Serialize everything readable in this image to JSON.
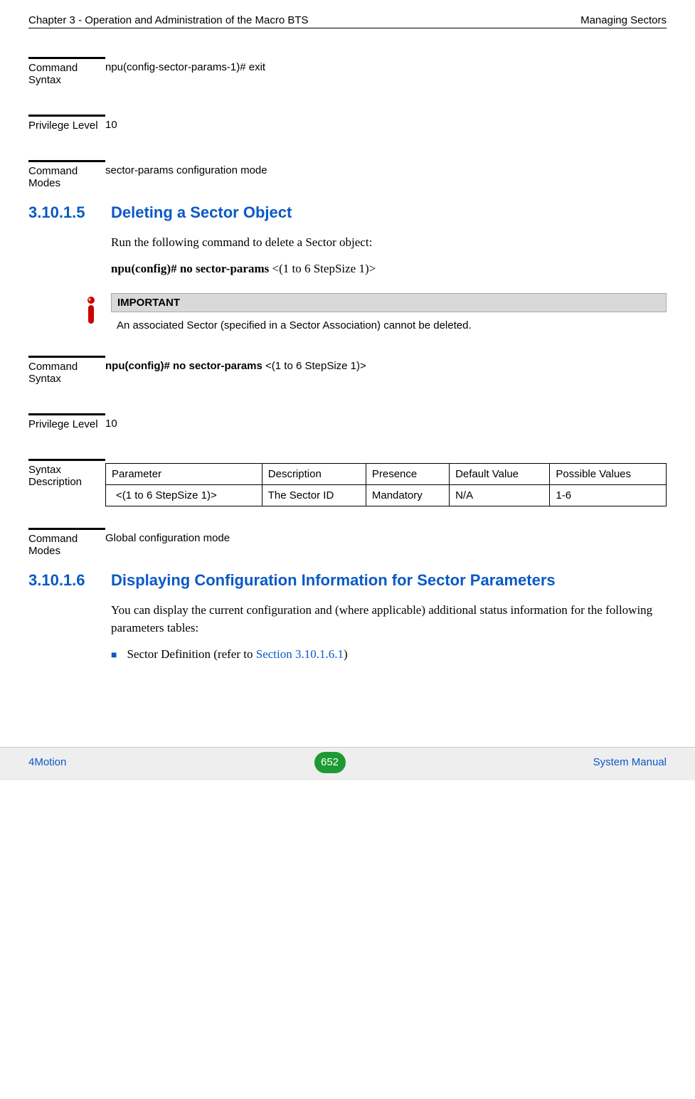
{
  "header": {
    "left": "Chapter 3 - Operation and Administration of the Macro BTS",
    "right": "Managing Sectors"
  },
  "block1": {
    "syntax_label": "Command Syntax",
    "syntax_value": "npu(config-sector-params-1)# exit",
    "privilege_label": "Privilege Level",
    "privilege_value": "10",
    "modes_label": "Command Modes",
    "modes_value": "sector-params configuration mode"
  },
  "section1": {
    "num": "3.10.1.5",
    "title": "Deleting a Sector Object",
    "intro": "Run the following command to delete a Sector object:",
    "cmd_prefix": "npu(config)# no sector-params ",
    "cmd_arg": "<(1 to 6 StepSize 1)>"
  },
  "important": {
    "title": "IMPORTANT",
    "text": "An associated Sector (specified in a Sector Association) cannot be deleted."
  },
  "block2": {
    "syntax_label": "Command Syntax",
    "syntax_bold": "npu(config)# no sector-params ",
    "syntax_plain": "<(1 to 6 StepSize 1)>",
    "privilege_label": "Privilege Level",
    "privilege_value": "10",
    "syntaxdesc_label": "Syntax Description",
    "modes_label": "Command Modes",
    "modes_value": "Global configuration mode"
  },
  "syntax_table": {
    "headers": {
      "parameter": "Parameter",
      "description": "Description",
      "presence": "Presence",
      "default": "Default Value",
      "possible": "Possible Values"
    },
    "row": {
      "parameter": "<(1 to 6 StepSize 1)>",
      "description": "The Sector ID",
      "presence": "Mandatory",
      "default": "N/A",
      "possible": "1-6"
    }
  },
  "section2": {
    "num": "3.10.1.6",
    "title": "Displaying Configuration Information for Sector Parameters",
    "intro": "You can display the current configuration and (where applicable) additional status information for the following parameters tables:",
    "li_text_pre": "Sector Definition (refer to ",
    "li_xref": "Section 3.10.1.6.1",
    "li_text_post": ")"
  },
  "footer": {
    "left": "4Motion",
    "page": "652",
    "right": "System Manual"
  }
}
